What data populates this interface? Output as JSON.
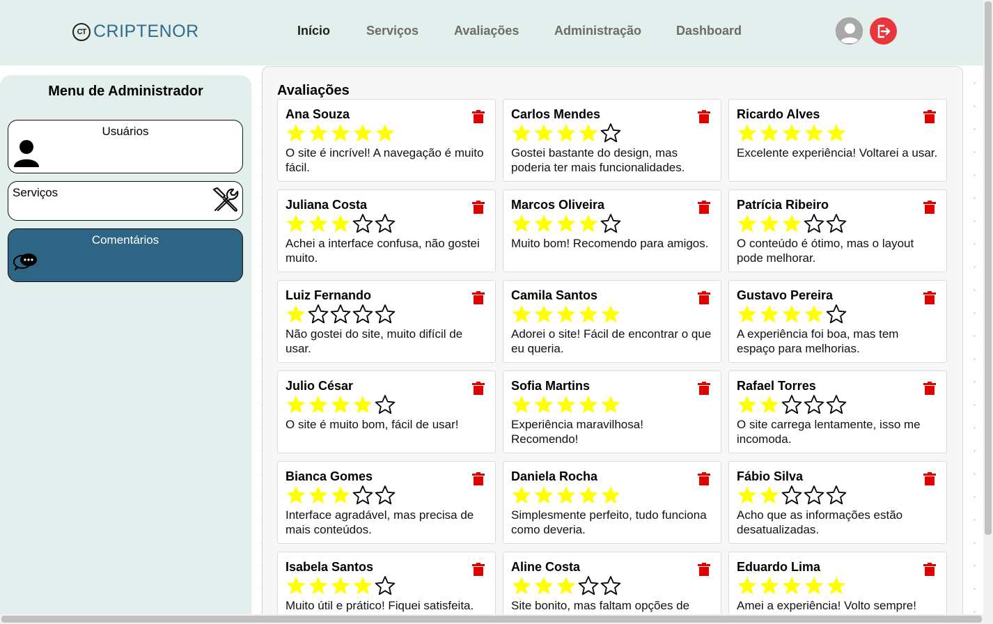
{
  "brand": {
    "logo_mark": "CT",
    "name": "CRIPTENOR"
  },
  "nav": {
    "items": [
      "Início",
      "Serviços",
      "Avaliações",
      "Administração",
      "Dashboard"
    ],
    "active_index": 0
  },
  "header_icons": [
    "user-avatar-icon",
    "logout-icon"
  ],
  "colors": {
    "header_bg": "#e2efec",
    "brand_blue": "#2f6c8f",
    "active_menu": "#2f6584",
    "star_filled": "#ffff00",
    "trash": "#e00000",
    "logout": "#e8363c"
  },
  "sidebar": {
    "title": "Menu de Administrador",
    "items": [
      {
        "label": "Usuários",
        "icon": "user-icon",
        "active": false
      },
      {
        "label": "Serviços",
        "icon": "tools-icon",
        "active": false
      },
      {
        "label": "Comentários",
        "icon": "chat-bubble-icon",
        "active": true
      }
    ]
  },
  "main": {
    "title": "Avaliações",
    "reviews": [
      {
        "name": "Ana Souza",
        "rating": 5,
        "comment": "O site é incrível! A navegação é muito fácil."
      },
      {
        "name": "Carlos Mendes",
        "rating": 4,
        "comment": "Gostei bastante do design, mas poderia ter mais funcionalidades."
      },
      {
        "name": "Ricardo Alves",
        "rating": 5,
        "comment": "Excelente experiência! Voltarei a usar."
      },
      {
        "name": "Juliana Costa",
        "rating": 3,
        "comment": "Achei a interface confusa, não gostei muito."
      },
      {
        "name": "Marcos Oliveira",
        "rating": 4,
        "comment": "Muito bom! Recomendo para amigos."
      },
      {
        "name": "Patrícia Ribeiro",
        "rating": 3,
        "comment": "O conteúdo é ótimo, mas o layout pode melhorar."
      },
      {
        "name": "Luiz Fernando",
        "rating": 1,
        "comment": "Não gostei do site, muito difícil de usar."
      },
      {
        "name": "Camila Santos",
        "rating": 5,
        "comment": "Adorei o site! Fácil de encontrar o que eu queria."
      },
      {
        "name": "Gustavo Pereira",
        "rating": 4,
        "comment": "A experiência foi boa, mas tem espaço para melhorias."
      },
      {
        "name": "Julio César",
        "rating": 4,
        "comment": "O site é muito bom, fácil de usar!"
      },
      {
        "name": "Sofia Martins",
        "rating": 5,
        "comment": "Experiência maravilhosa! Recomendo!"
      },
      {
        "name": "Rafael Torres",
        "rating": 2,
        "comment": "O site carrega lentamente, isso me incomoda."
      },
      {
        "name": "Bianca Gomes",
        "rating": 3,
        "comment": "Interface agradável, mas precisa de mais conteúdos."
      },
      {
        "name": "Daniela Rocha",
        "rating": 5,
        "comment": "Simplesmente perfeito, tudo funciona como deveria."
      },
      {
        "name": "Fábio Silva",
        "rating": 2,
        "comment": "Acho que as informações estão desatualizadas."
      },
      {
        "name": "Isabela Santos",
        "rating": 4,
        "comment": "Muito útil e prático! Fiquei satisfeita."
      },
      {
        "name": "Aline Costa",
        "rating": 3,
        "comment": "Site bonito, mas faltam opções de"
      },
      {
        "name": "Eduardo Lima",
        "rating": 5,
        "comment": "Amei a experiência! Volto sempre!"
      }
    ]
  }
}
